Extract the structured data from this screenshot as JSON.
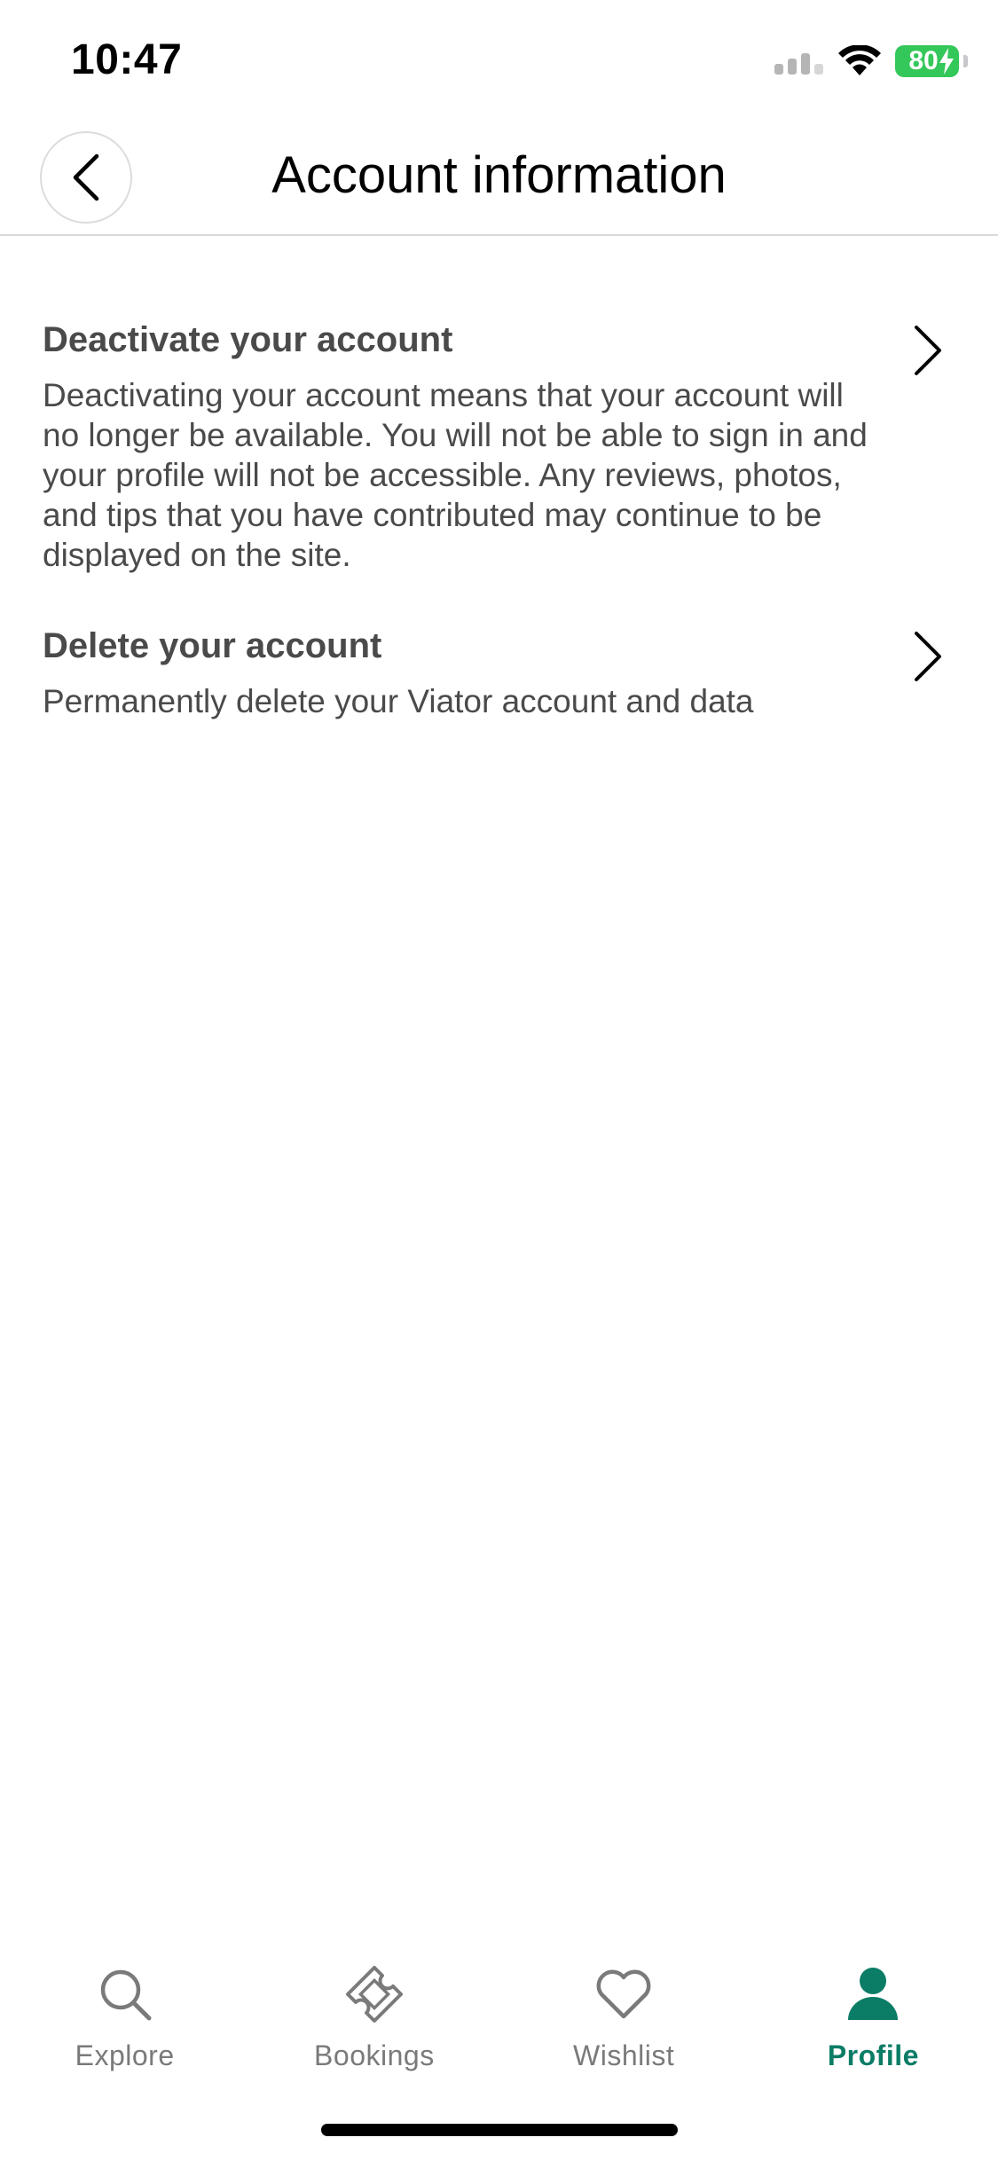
{
  "status_bar": {
    "time": "10:47",
    "battery_level": "80",
    "icons": [
      "signal-icon",
      "wifi-icon",
      "battery-charging-icon"
    ]
  },
  "header": {
    "title": "Account information",
    "back_icon": "chevron-left-icon"
  },
  "items": [
    {
      "title": "Deactivate your account",
      "description": "Deactivating your account means that your account will no longer be available. You will not be able to sign in and your profile will not be accessible. Any reviews, photos, and tips that you have contributed may continue to be displayed on the site.",
      "icon": "chevron-right-icon"
    },
    {
      "title": "Delete your account",
      "description": "Permanently delete your Viator account and data",
      "icon": "chevron-right-icon"
    }
  ],
  "tab_bar": {
    "tabs": [
      {
        "label": "Explore",
        "icon": "search-icon",
        "active": false
      },
      {
        "label": "Bookings",
        "icon": "ticket-icon",
        "active": false
      },
      {
        "label": "Wishlist",
        "icon": "heart-icon",
        "active": false
      },
      {
        "label": "Profile",
        "icon": "person-icon",
        "active": true
      }
    ]
  },
  "colors": {
    "accent": "#0b7c66",
    "inactive_tab": "#7a7a7a",
    "text": "#4a4a4a",
    "battery": "#34c759"
  }
}
